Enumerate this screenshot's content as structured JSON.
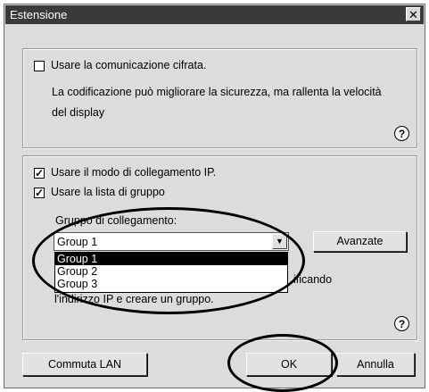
{
  "window": {
    "title": "Estensione",
    "close_glyph": "✕"
  },
  "encryption": {
    "checkbox_label": "Usare la comunicazione cifrata.",
    "checked": false,
    "description_line1": "La codificazione può migliorare la sicurezza, ma rallenta la velocità",
    "description_line2": "del display"
  },
  "connection": {
    "ip_mode_label": "Usare il modo di collegamento IP.",
    "ip_mode_checked": true,
    "group_list_label": "Usare la lista di gruppo",
    "group_list_checked": true,
    "group_label": "Gruppo di collegamento:",
    "selected_group": "Group 1",
    "options": [
      "Group 1",
      "Group 2",
      "Group 3"
    ],
    "advanced_button": "Avanzate",
    "hint_line1_fragment": "ificando",
    "hint_line2": "l'indirizzo IP e creare un gruppo."
  },
  "help_glyph": "?",
  "check_glyph": "✓",
  "dropdown_arrow": "▼",
  "footer": {
    "lan_button": "Commuta LAN",
    "ok_button": "OK",
    "cancel_button": "Annulla"
  }
}
